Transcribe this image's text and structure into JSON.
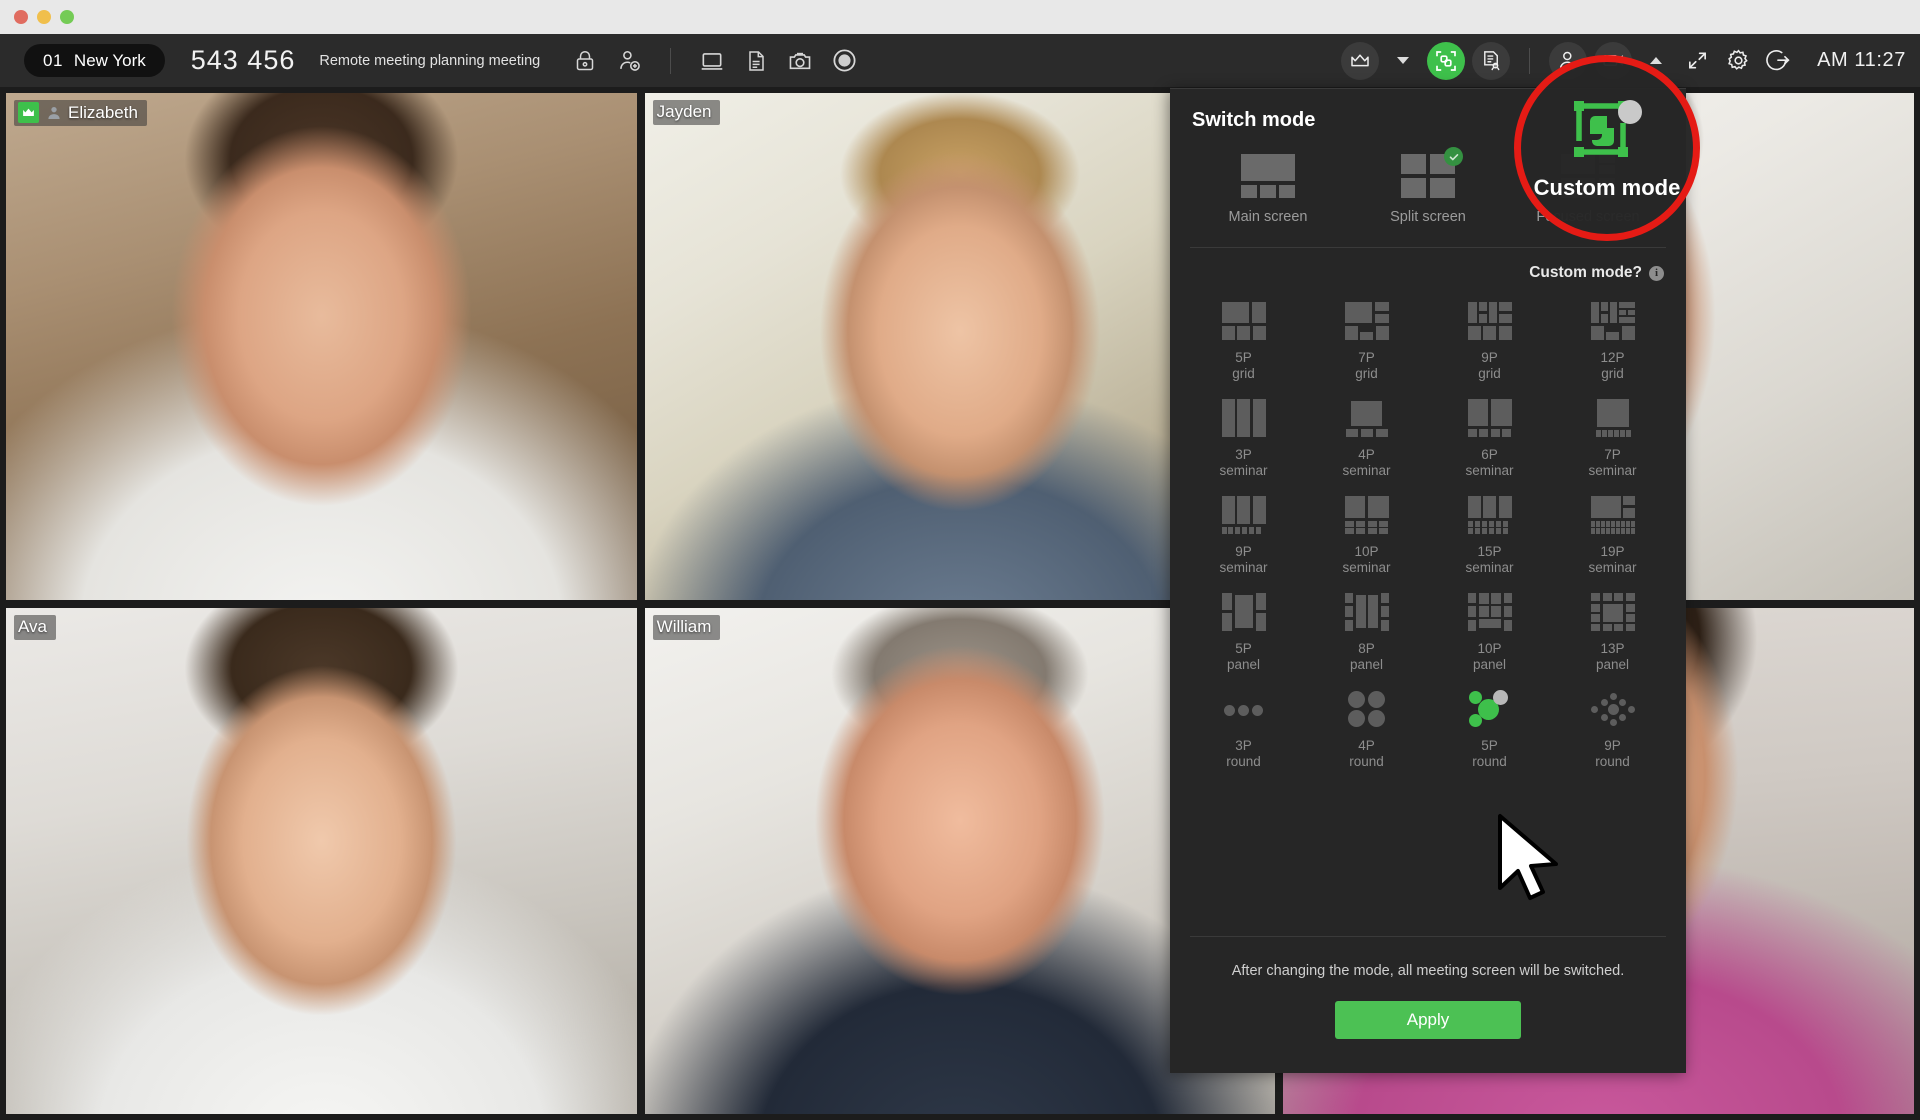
{
  "window": {
    "controls": [
      "close",
      "minimize",
      "maximize"
    ]
  },
  "toolbar": {
    "room_number": "01",
    "room_name": "New York",
    "meeting_id": "543 456",
    "meeting_title": "Remote meeting planning meeting",
    "clock": "AM 11:27",
    "left_icons": [
      {
        "name": "lock-icon",
        "label": "Lock meeting"
      },
      {
        "name": "add-participant-icon",
        "label": "Invite participant"
      }
    ],
    "center_icons": [
      {
        "name": "screen-share-icon",
        "label": "Share screen"
      },
      {
        "name": "document-icon",
        "label": "Share document"
      },
      {
        "name": "camera-snapshot-icon",
        "label": "Snapshot"
      },
      {
        "name": "record-icon",
        "label": "Record"
      }
    ],
    "right_icons": [
      {
        "name": "crown-icon",
        "label": "Host"
      },
      {
        "name": "chevron-down-icon",
        "label": "Host options"
      },
      {
        "name": "custom-mode-icon",
        "label": "Switch mode",
        "active": true,
        "color": "#3ec04b"
      },
      {
        "name": "minutes-icon",
        "label": "Meeting minutes"
      },
      {
        "name": "participant-icon",
        "label": "Participants"
      },
      {
        "name": "camera-icon",
        "label": "Camera"
      },
      {
        "name": "chevron-up-icon",
        "label": "Camera options"
      },
      {
        "name": "fullscreen-icon",
        "label": "Full screen"
      },
      {
        "name": "settings-icon",
        "label": "Settings"
      },
      {
        "name": "exit-icon",
        "label": "Leave meeting"
      }
    ]
  },
  "participants": [
    {
      "name": "Elizabeth",
      "host": true,
      "has_person_icon": true
    },
    {
      "name": "Jayden",
      "host": false,
      "has_person_icon": false
    },
    {
      "name": "Ava",
      "host": false,
      "has_person_icon": false
    },
    {
      "name": "William",
      "host": false,
      "has_person_icon": false
    }
  ],
  "panel": {
    "title": "Switch mode",
    "top_modes": [
      {
        "label": "Main screen",
        "selected": false
      },
      {
        "label": "Split screen",
        "selected": true
      },
      {
        "label": "Focused screen",
        "selected": false
      }
    ],
    "custom_question": "Custom mode?",
    "info_glyph": "i",
    "mode_rows": [
      [
        {
          "count": "5P",
          "kind": "grid"
        },
        {
          "count": "7P",
          "kind": "grid"
        },
        {
          "count": "9P",
          "kind": "grid"
        },
        {
          "count": "12P",
          "kind": "grid"
        }
      ],
      [
        {
          "count": "3P",
          "kind": "seminar"
        },
        {
          "count": "4P",
          "kind": "seminar"
        },
        {
          "count": "6P",
          "kind": "seminar"
        },
        {
          "count": "7P",
          "kind": "seminar"
        }
      ],
      [
        {
          "count": "9P",
          "kind": "seminar"
        },
        {
          "count": "10P",
          "kind": "seminar"
        },
        {
          "count": "15P",
          "kind": "seminar"
        },
        {
          "count": "19P",
          "kind": "seminar"
        }
      ],
      [
        {
          "count": "5P",
          "kind": "panel"
        },
        {
          "count": "8P",
          "kind": "panel"
        },
        {
          "count": "10P",
          "kind": "panel"
        },
        {
          "count": "13P",
          "kind": "panel"
        }
      ],
      [
        {
          "count": "3P",
          "kind": "round"
        },
        {
          "count": "4P",
          "kind": "round"
        },
        {
          "count": "5P",
          "kind": "round",
          "highlighted": true
        },
        {
          "count": "9P",
          "kind": "round"
        }
      ]
    ],
    "footer_note": "After changing the mode, all meeting screen will be switched.",
    "apply_label": "Apply"
  },
  "callout": {
    "label": "Custom mode",
    "ring_color": "#e51b15",
    "icon_color": "#3ec04b"
  }
}
